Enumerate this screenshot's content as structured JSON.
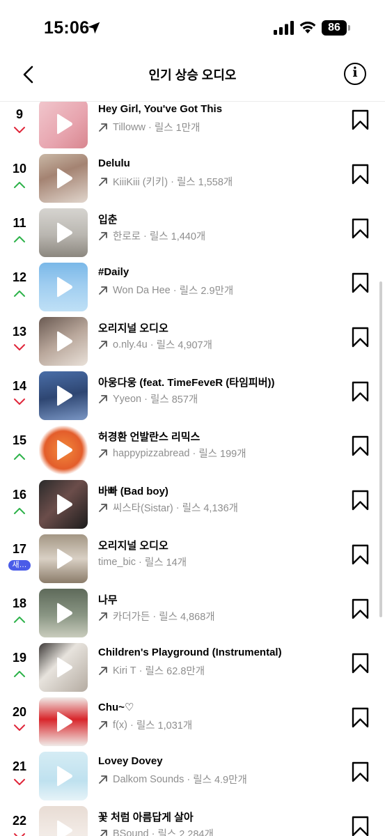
{
  "status_bar": {
    "time": "15:06",
    "battery": "86"
  },
  "header": {
    "title": "인기 상승 오디오"
  },
  "items": [
    {
      "rank": "9",
      "trend": "down",
      "title": "Hey Girl, You've Got This",
      "artist": "Tilloww",
      "reels": "릴스 1만개",
      "artist_link": true,
      "art": "linear-gradient(135deg,#f1c7cd 0%,#e7a4ae 60%,#d8868f 100%)"
    },
    {
      "rank": "10",
      "trend": "up",
      "title": "Delulu",
      "artist": "KiiiKiii (키키)",
      "reels": "릴스 1,558개",
      "artist_link": true,
      "art": "linear-gradient(160deg,#c9b8a6 0%,#a48372 40%,#e1d6cd 100%)"
    },
    {
      "rank": "11",
      "trend": "up",
      "title": "입춘",
      "artist": "한로로",
      "reels": "릴스 1,440개",
      "artist_link": true,
      "art": "linear-gradient(180deg,#d6d4d0 0%,#b9b6b0 55%,#8c877f 100%)"
    },
    {
      "rank": "12",
      "trend": "up",
      "title": "#Daily",
      "artist": "Won Da Hee",
      "reels": "릴스 2.9만개",
      "artist_link": true,
      "art": "linear-gradient(180deg,#7ab8e8 0%,#9fcdf0 45%,#bfe0f6 100%)"
    },
    {
      "rank": "13",
      "trend": "down",
      "title": "오리지널 오디오",
      "artist": "o.nly.4u",
      "reels": "릴스 4,907개",
      "artist_link": true,
      "art": "linear-gradient(150deg,#6a5a52 0%,#b9a79b 50%,#e9e1d9 100%)"
    },
    {
      "rank": "14",
      "trend": "down",
      "title": "아웅다웅 (feat. TimeFeveR (타임피버))",
      "artist": "Yyeon",
      "reels": "릴스 857개",
      "artist_link": true,
      "art": "linear-gradient(170deg,#4a6ea8 0%,#2e4672 50%,#7a96c4 100%)"
    },
    {
      "rank": "15",
      "trend": "up",
      "title": "허경환 언발란스 리믹스",
      "artist": "happypizzabread",
      "reels": "릴스 199개",
      "artist_link": true,
      "art": "radial-gradient(circle at 50% 50%,#f28a3c 0%,#e35d2b 55%,#ffffff 72%)"
    },
    {
      "rank": "16",
      "trend": "up",
      "title": "바빠 (Bad boy)",
      "artist": "씨스타(Sistar)",
      "reels": "릴스 4,136개",
      "artist_link": true,
      "art": "linear-gradient(135deg,#2b2b2b 0%,#6b4d4a 45%,#1c1c1c 100%)"
    },
    {
      "rank": "17",
      "trend": "new",
      "new_label": "새…",
      "title": "오리지널 오디오",
      "artist": "time_bic",
      "reels": "릴스 14개",
      "artist_link": false,
      "art": "linear-gradient(180deg,#a39684 0%,#d9d0c4 50%,#8b7c6a 100%)"
    },
    {
      "rank": "18",
      "trend": "up",
      "title": "나무",
      "artist": "카더가든",
      "reels": "릴스 4,868개",
      "artist_link": true,
      "art": "linear-gradient(180deg,#5e6a5a 0%,#8a9684 55%,#c9ccbd 100%)"
    },
    {
      "rank": "19",
      "trend": "up",
      "title": "Children's Playground (Instrumental)",
      "artist": "Kiri T",
      "reels": "릴스 62.8만개",
      "artist_link": true,
      "art": "linear-gradient(135deg,#3d3a38 0%,#e7e3dd 40%,#b4aba1 100%)"
    },
    {
      "rank": "20",
      "trend": "down",
      "title": "Chu~♡",
      "artist": "f(x)",
      "reels": "릴스 1,031개",
      "artist_link": true,
      "art": "linear-gradient(180deg,#f0ebe8 0%,#d8262b 45%,#f0ebe8 100%)"
    },
    {
      "rank": "21",
      "trend": "down",
      "title": "Lovey Dovey",
      "artist": "Dalkom Sounds",
      "reels": "릴스 4.9만개",
      "artist_link": true,
      "art": "linear-gradient(180deg,#d5ecf4 0%,#bfe1ef 60%,#e6f3f8 100%)"
    },
    {
      "rank": "22",
      "trend": "down",
      "title": "꽃 처럼 아름답게 살아",
      "artist": "BSound",
      "reels": "릴스 2,284개",
      "artist_link": true,
      "art": "linear-gradient(180deg,#e8dcd4 0%,#f3ece7 60%,#d9c9bf 100%)"
    }
  ],
  "colors": {
    "up": "#2db24a",
    "down": "#e0263a",
    "new_badge": "#4a5ce8",
    "meta_text": "#8e8e8e"
  },
  "icons": {
    "back": "chevron-left-icon",
    "info": "info-icon",
    "play": "play-icon",
    "bookmark": "bookmark-icon",
    "artist": "arrow-up-right-icon"
  }
}
